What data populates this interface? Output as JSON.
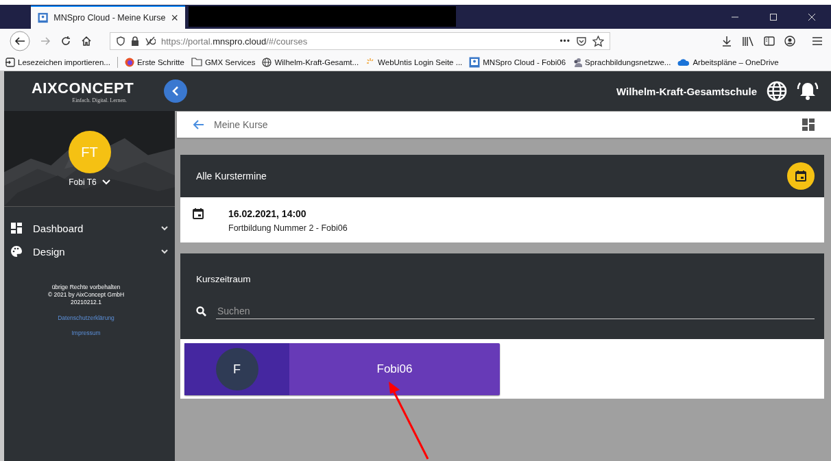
{
  "browser": {
    "tab_title": "MNSpro Cloud - Meine Kurse",
    "tab_close": "×",
    "url_prefix": "https://portal.",
    "url_domain": "mnspro.cloud",
    "url_suffix": "/#/courses",
    "page_actions": "•••",
    "bookmarks": [
      {
        "kind": "import",
        "label": "Lesezeichen importieren..."
      },
      {
        "kind": "firefox",
        "label": "Erste Schritte"
      },
      {
        "kind": "folder",
        "label": "GMX Services"
      },
      {
        "kind": "globe",
        "label": "Wilhelm-Kraft-Gesamt..."
      },
      {
        "kind": "webuntis",
        "label": "WebUntis Login Seite ..."
      },
      {
        "kind": "mnspro",
        "label": "MNSpro Cloud - Fobi06"
      },
      {
        "kind": "people",
        "label": "Sprachbildungsnetzwe..."
      },
      {
        "kind": "cloud",
        "label": "Arbeitspläne – OneDrive"
      }
    ]
  },
  "app": {
    "logo": "AIXCONCEPT",
    "tagline": "Einfach. Digital. Lernen.",
    "school": "Wilhelm-Kraft-Gesamtschule"
  },
  "sidebar": {
    "initials": "FT",
    "user": "Fobi T6",
    "items": [
      {
        "kind": "dashboard",
        "label": "Dashboard",
        "expanded": false
      },
      {
        "kind": "palette",
        "label": "Design",
        "expanded": false
      }
    ],
    "footer": [
      "übrige Rechte vorbehalten",
      "© 2021 by AixConcept GmbH",
      "20210212.1"
    ],
    "links": [
      "Datenschutzerklärung",
      "Impressum"
    ]
  },
  "breadcrumb": "Meine Kurse",
  "events_card": {
    "title": "Alle Kurstermine",
    "events": [
      {
        "date": "16.02.2021, 14:00",
        "title": "Fortbildung Nummer 2 - Fobi06"
      }
    ]
  },
  "courses_card": {
    "title": "Kurszeitraum",
    "search": {
      "placeholder": "Suchen"
    },
    "courses": [
      {
        "initial": "F",
        "name": "Fobi06"
      }
    ]
  }
}
